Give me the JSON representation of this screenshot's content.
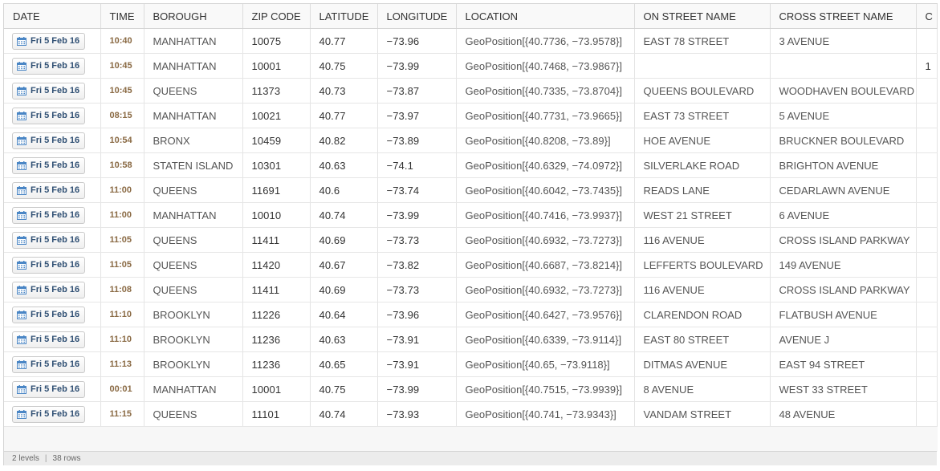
{
  "columns": [
    "DATE",
    "TIME",
    "BOROUGH",
    "ZIP CODE",
    "LATITUDE",
    "LONGITUDE",
    "LOCATION",
    "ON STREET NAME",
    "CROSS STREET NAME",
    "C"
  ],
  "rows": [
    {
      "date": "Fri 5 Feb 16",
      "time": "10:40",
      "borough": "MANHATTAN",
      "zip": "10075",
      "lat": "40.77",
      "lon": "−73.96",
      "location": "GeoPosition[{40.7736, −73.9578}]",
      "on_street": "EAST 78 STREET",
      "cross_street": "3 AVENUE",
      "extra": ""
    },
    {
      "date": "Fri 5 Feb 16",
      "time": "10:45",
      "borough": "MANHATTAN",
      "zip": "10001",
      "lat": "40.75",
      "lon": "−73.99",
      "location": "GeoPosition[{40.7468, −73.9867}]",
      "on_street": "",
      "cross_street": "",
      "extra": "1"
    },
    {
      "date": "Fri 5 Feb 16",
      "time": "10:45",
      "borough": "QUEENS",
      "zip": "11373",
      "lat": "40.73",
      "lon": "−73.87",
      "location": "GeoPosition[{40.7335, −73.8704}]",
      "on_street": "QUEENS BOULEVARD",
      "cross_street": "WOODHAVEN BOULEVARD",
      "extra": ""
    },
    {
      "date": "Fri 5 Feb 16",
      "time": "08:15",
      "borough": "MANHATTAN",
      "zip": "10021",
      "lat": "40.77",
      "lon": "−73.97",
      "location": "GeoPosition[{40.7731, −73.9665}]",
      "on_street": "EAST 73 STREET",
      "cross_street": "5 AVENUE",
      "extra": ""
    },
    {
      "date": "Fri 5 Feb 16",
      "time": "10:54",
      "borough": "BRONX",
      "zip": "10459",
      "lat": "40.82",
      "lon": "−73.89",
      "location": "GeoPosition[{40.8208, −73.89}]",
      "on_street": "HOE AVENUE",
      "cross_street": "BRUCKNER BOULEVARD",
      "extra": ""
    },
    {
      "date": "Fri 5 Feb 16",
      "time": "10:58",
      "borough": "STATEN ISLAND",
      "zip": "10301",
      "lat": "40.63",
      "lon": "−74.1",
      "location": "GeoPosition[{40.6329, −74.0972}]",
      "on_street": "SILVERLAKE ROAD",
      "cross_street": "BRIGHTON AVENUE",
      "extra": ""
    },
    {
      "date": "Fri 5 Feb 16",
      "time": "11:00",
      "borough": "QUEENS",
      "zip": "11691",
      "lat": "40.6",
      "lon": "−73.74",
      "location": "GeoPosition[{40.6042, −73.7435}]",
      "on_street": "READS LANE",
      "cross_street": "CEDARLAWN AVENUE",
      "extra": ""
    },
    {
      "date": "Fri 5 Feb 16",
      "time": "11:00",
      "borough": "MANHATTAN",
      "zip": "10010",
      "lat": "40.74",
      "lon": "−73.99",
      "location": "GeoPosition[{40.7416, −73.9937}]",
      "on_street": "WEST 21 STREET",
      "cross_street": "6 AVENUE",
      "extra": ""
    },
    {
      "date": "Fri 5 Feb 16",
      "time": "11:05",
      "borough": "QUEENS",
      "zip": "11411",
      "lat": "40.69",
      "lon": "−73.73",
      "location": "GeoPosition[{40.6932, −73.7273}]",
      "on_street": "116 AVENUE",
      "cross_street": "CROSS ISLAND PARKWAY",
      "extra": ""
    },
    {
      "date": "Fri 5 Feb 16",
      "time": "11:05",
      "borough": "QUEENS",
      "zip": "11420",
      "lat": "40.67",
      "lon": "−73.82",
      "location": "GeoPosition[{40.6687, −73.8214}]",
      "on_street": "LEFFERTS BOULEVARD",
      "cross_street": "149 AVENUE",
      "extra": ""
    },
    {
      "date": "Fri 5 Feb 16",
      "time": "11:08",
      "borough": "QUEENS",
      "zip": "11411",
      "lat": "40.69",
      "lon": "−73.73",
      "location": "GeoPosition[{40.6932, −73.7273}]",
      "on_street": "116 AVENUE",
      "cross_street": "CROSS ISLAND PARKWAY",
      "extra": ""
    },
    {
      "date": "Fri 5 Feb 16",
      "time": "11:10",
      "borough": "BROOKLYN",
      "zip": "11226",
      "lat": "40.64",
      "lon": "−73.96",
      "location": "GeoPosition[{40.6427, −73.9576}]",
      "on_street": "CLARENDON ROAD",
      "cross_street": "FLATBUSH AVENUE",
      "extra": ""
    },
    {
      "date": "Fri 5 Feb 16",
      "time": "11:10",
      "borough": "BROOKLYN",
      "zip": "11236",
      "lat": "40.63",
      "lon": "−73.91",
      "location": "GeoPosition[{40.6339, −73.9114}]",
      "on_street": "EAST 80 STREET",
      "cross_street": "AVENUE J",
      "extra": ""
    },
    {
      "date": "Fri 5 Feb 16",
      "time": "11:13",
      "borough": "BROOKLYN",
      "zip": "11236",
      "lat": "40.65",
      "lon": "−73.91",
      "location": "GeoPosition[{40.65, −73.9118}]",
      "on_street": "DITMAS AVENUE",
      "cross_street": "EAST 94 STREET",
      "extra": ""
    },
    {
      "date": "Fri 5 Feb 16",
      "time": "00:01",
      "borough": "MANHATTAN",
      "zip": "10001",
      "lat": "40.75",
      "lon": "−73.99",
      "location": "GeoPosition[{40.7515, −73.9939}]",
      "on_street": "8 AVENUE",
      "cross_street": "WEST 33 STREET",
      "extra": ""
    },
    {
      "date": "Fri 5 Feb 16",
      "time": "11:15",
      "borough": "QUEENS",
      "zip": "11101",
      "lat": "40.74",
      "lon": "−73.93",
      "location": "GeoPosition[{40.741, −73.9343}]",
      "on_street": "VANDAM STREET",
      "cross_street": "48 AVENUE",
      "extra": ""
    }
  ],
  "status": {
    "levels": "2 levels",
    "rows": "38 rows"
  },
  "colors": {
    "date_text": "#2f4f73",
    "calendar_icon": "#4a86c5",
    "time_text": "#8a6a44"
  },
  "icons": {
    "date_cell": "calendar-icon"
  }
}
